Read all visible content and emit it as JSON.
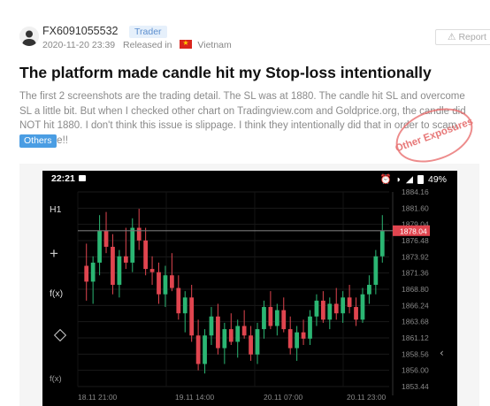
{
  "post": {
    "username": "FX6091055532",
    "role": "Trader",
    "date": "2020-11-20 23:39",
    "released_label": "Released in",
    "country": "Vietnam",
    "report_label": "Report",
    "title": "The platform made candle hit my Stop-loss intentionally",
    "body": "The first 2 screenshots are the trading detail. The SL was at 1880. The candle hit SL and overcome SL a little bit. But when I checked other chart on Tradingview.com and Goldprice.org, the candle did NOT hit 1880. I don't think this issue is slippage. I think they intentionally did that in order to scam. Be aware!!",
    "tag": "Others",
    "stamp": "Other Exposures"
  },
  "phone": {
    "time": "22:21",
    "battery": "49%",
    "timeframe": "H1",
    "fx_label": "f(x)",
    "fx2_label": "f(x)",
    "current_price": "1878.04",
    "price_ticks": [
      "1884.16",
      "1881.60",
      "1879.04",
      "1876.48",
      "1873.92",
      "1871.36",
      "1868.80",
      "1866.24",
      "1863.68",
      "1861.12",
      "1858.56",
      "1856.00",
      "1853.44"
    ],
    "time_ticks": [
      "18.11 21:00",
      "19.11 14:00",
      "20.11 07:00",
      "20.11 23:00"
    ],
    "colors": {
      "up": "#2bb673",
      "down": "#e0454f",
      "price_tag": "#e0454f"
    }
  },
  "chart_data": {
    "type": "candlestick",
    "x": [
      "18.11 21:00",
      "19.11 14:00",
      "20.11 07:00",
      "20.11 23:00"
    ],
    "ylim": [
      1853.44,
      1884.16
    ],
    "current": 1878.04,
    "candles": [
      [
        1872.5,
        1876.0,
        1867.0,
        1870.0
      ],
      [
        1870.0,
        1874.0,
        1866.5,
        1873.0
      ],
      [
        1873.0,
        1880.5,
        1871.0,
        1878.0
      ],
      [
        1878.0,
        1881.0,
        1874.5,
        1875.5
      ],
      [
        1875.5,
        1877.5,
        1868.0,
        1869.5
      ],
      [
        1869.5,
        1875.0,
        1867.5,
        1874.0
      ],
      [
        1874.0,
        1878.5,
        1872.0,
        1873.0
      ],
      [
        1873.0,
        1880.0,
        1871.5,
        1878.5
      ],
      [
        1878.5,
        1881.5,
        1875.0,
        1876.5
      ],
      [
        1876.5,
        1878.5,
        1871.0,
        1872.0
      ],
      [
        1872.0,
        1874.0,
        1869.5,
        1871.5
      ],
      [
        1871.5,
        1873.0,
        1866.5,
        1868.0
      ],
      [
        1868.0,
        1872.5,
        1866.0,
        1871.0
      ],
      [
        1871.0,
        1874.5,
        1868.5,
        1869.0
      ],
      [
        1869.0,
        1871.0,
        1864.0,
        1865.0
      ],
      [
        1865.0,
        1868.5,
        1862.0,
        1867.5
      ],
      [
        1867.5,
        1869.5,
        1860.5,
        1861.5
      ],
      [
        1861.5,
        1864.0,
        1856.0,
        1857.0
      ],
      [
        1857.0,
        1862.5,
        1855.5,
        1861.5
      ],
      [
        1861.5,
        1866.0,
        1860.0,
        1864.5
      ],
      [
        1864.5,
        1866.5,
        1858.5,
        1859.5
      ],
      [
        1859.5,
        1863.5,
        1857.0,
        1862.5
      ],
      [
        1862.5,
        1865.0,
        1860.0,
        1860.5
      ],
      [
        1860.5,
        1864.0,
        1858.0,
        1863.0
      ],
      [
        1863.0,
        1865.5,
        1861.0,
        1861.5
      ],
      [
        1861.5,
        1863.0,
        1857.5,
        1858.5
      ],
      [
        1858.5,
        1863.5,
        1857.0,
        1862.5
      ],
      [
        1862.5,
        1867.0,
        1861.0,
        1866.0
      ],
      [
        1866.0,
        1868.5,
        1862.5,
        1863.0
      ],
      [
        1863.0,
        1866.5,
        1861.5,
        1865.5
      ],
      [
        1865.5,
        1867.5,
        1862.0,
        1862.5
      ],
      [
        1862.5,
        1864.5,
        1858.5,
        1859.5
      ],
      [
        1859.5,
        1863.0,
        1857.5,
        1862.0
      ],
      [
        1862.0,
        1864.0,
        1860.0,
        1861.0
      ],
      [
        1861.0,
        1865.5,
        1860.0,
        1864.5
      ],
      [
        1864.5,
        1868.0,
        1863.0,
        1867.0
      ],
      [
        1867.0,
        1868.5,
        1863.5,
        1864.0
      ],
      [
        1864.0,
        1867.5,
        1862.5,
        1866.5
      ],
      [
        1866.5,
        1869.0,
        1864.0,
        1865.0
      ],
      [
        1865.0,
        1868.5,
        1863.5,
        1867.5
      ],
      [
        1867.5,
        1869.5,
        1865.0,
        1866.0
      ],
      [
        1866.0,
        1867.5,
        1863.0,
        1864.0
      ],
      [
        1864.0,
        1869.0,
        1863.5,
        1868.0
      ],
      [
        1868.0,
        1871.0,
        1866.5,
        1869.5
      ],
      [
        1869.5,
        1875.0,
        1868.0,
        1874.0
      ],
      [
        1874.0,
        1880.5,
        1873.0,
        1878.0
      ]
    ]
  }
}
